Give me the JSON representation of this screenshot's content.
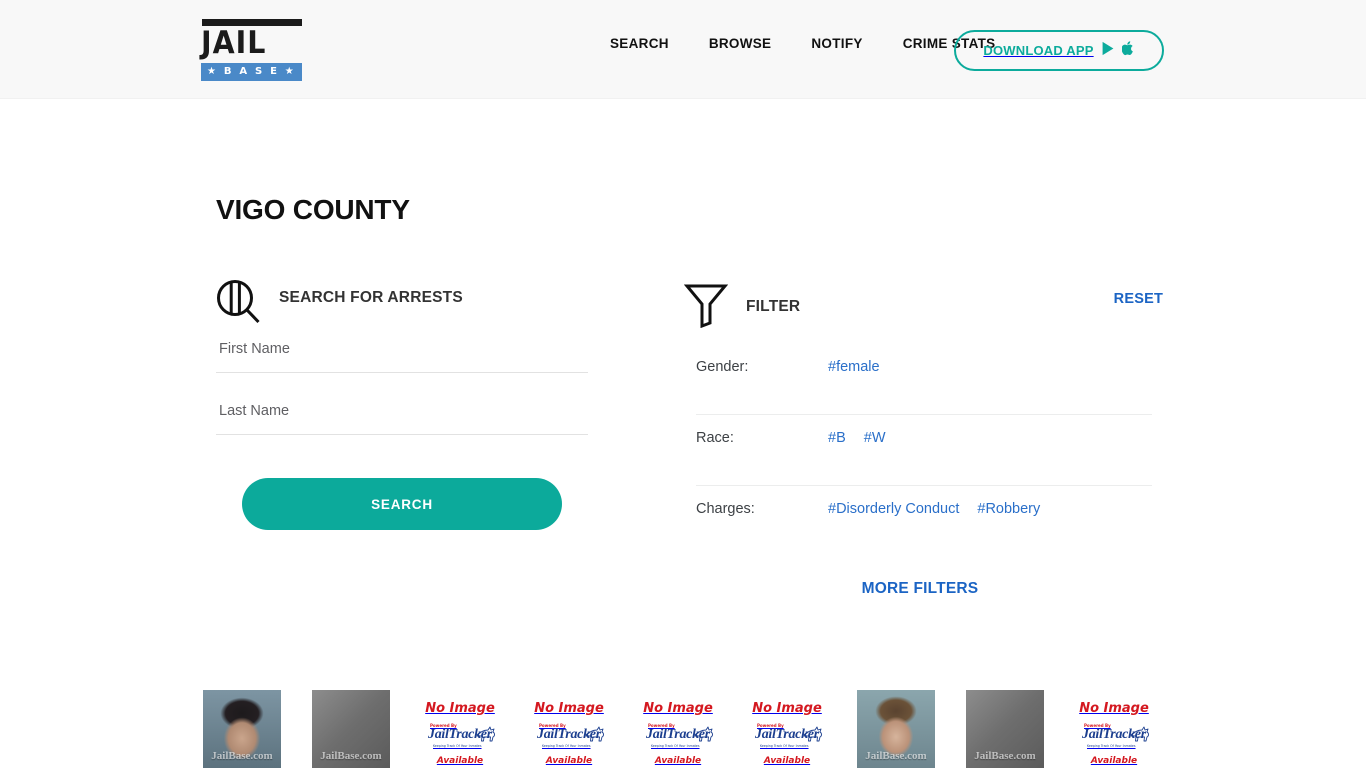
{
  "brand": {
    "logo_word": "JAIL",
    "logo_base": "★ B A S E ★",
    "colors": {
      "teal": "#0caa9b",
      "blue_link": "#1b64c4",
      "logo_blue": "#4a89c8"
    }
  },
  "header": {
    "nav": [
      {
        "label": "SEARCH",
        "name": "nav-search"
      },
      {
        "label": "BROWSE",
        "name": "nav-browse"
      },
      {
        "label": "NOTIFY",
        "name": "nav-notify"
      },
      {
        "label": "CRIME STATS",
        "name": "nav-crime-stats"
      }
    ],
    "download": {
      "label": "DOWNLOAD APP",
      "play_icon": "google-play-icon",
      "apple_icon": "apple-icon"
    }
  },
  "page": {
    "title": "VIGO COUNTY"
  },
  "search": {
    "icon": "jail-bars-magnifier-icon",
    "heading": "SEARCH FOR ARRESTS",
    "first_name": {
      "placeholder": "First Name",
      "value": ""
    },
    "last_name": {
      "placeholder": "Last Name",
      "value": ""
    },
    "submit_label": "SEARCH"
  },
  "filter": {
    "icon": "funnel-icon",
    "heading": "FILTER",
    "reset_label": "RESET",
    "rows": [
      {
        "label": "Gender:",
        "tags": [
          "#female"
        ]
      },
      {
        "label": "Race:",
        "tags": [
          "#B",
          "#W"
        ]
      },
      {
        "label": "Charges:",
        "tags": [
          "#Disorderly Conduct",
          "#Robbery"
        ]
      }
    ],
    "more_label": "MORE FILTERS"
  },
  "results": {
    "watermark": "JailBase.com",
    "no_image": {
      "title": "No Image",
      "powered": "Powered By",
      "brand": "JailTracker",
      "tagline": "Keeping Track Of Your Inmates",
      "sub": "Available"
    },
    "thumbnails": [
      {
        "kind": "photo",
        "variant": "p1",
        "alt": "mugshot-1"
      },
      {
        "kind": "gray",
        "variant": "",
        "alt": "mugshot-2"
      },
      {
        "kind": "noimage",
        "variant": "",
        "alt": "mugshot-3"
      },
      {
        "kind": "noimage",
        "variant": "",
        "alt": "mugshot-4"
      },
      {
        "kind": "noimage",
        "variant": "",
        "alt": "mugshot-5"
      },
      {
        "kind": "noimage",
        "variant": "",
        "alt": "mugshot-6"
      },
      {
        "kind": "photo",
        "variant": "p2",
        "alt": "mugshot-7"
      },
      {
        "kind": "gray",
        "variant": "",
        "alt": "mugshot-8"
      },
      {
        "kind": "noimage",
        "variant": "",
        "alt": "mugshot-9"
      }
    ]
  }
}
